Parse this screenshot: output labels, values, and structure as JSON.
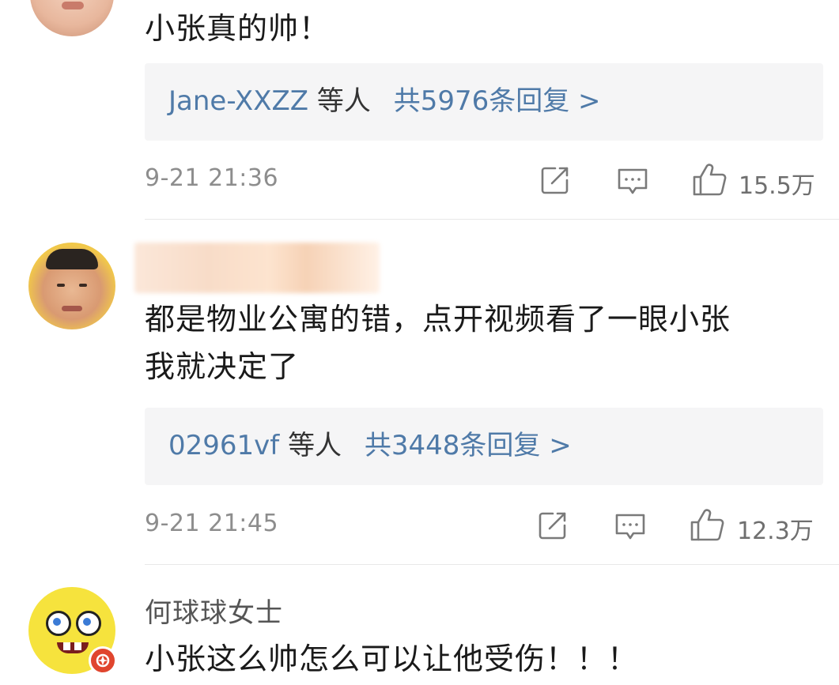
{
  "comments": [
    {
      "text": "小张真的帅！",
      "replies": {
        "users": "Jane-XXZZ",
        "etc": "等人",
        "total": "共5976条回复 >"
      },
      "time": "9-21 21:36",
      "likes": "15.5万"
    },
    {
      "text_line1": "都是物业公寓的错，点开视频看了一眼小张",
      "text_line2": "我就决定了",
      "replies": {
        "users": "02961vf",
        "etc": "等人",
        "total": "共3448条回复 >"
      },
      "time": "9-21 21:45",
      "likes": "12.3万"
    },
    {
      "username": "何球球女士",
      "text": "小张这么帅怎么可以让他受伤！！！"
    }
  ],
  "colors": {
    "link": "#4f7aa8",
    "meta": "#8d8d8d",
    "reply_bg": "#f5f5f6"
  },
  "icons": [
    "share-icon",
    "comment-icon",
    "like-icon",
    "verified-badge-icon"
  ]
}
